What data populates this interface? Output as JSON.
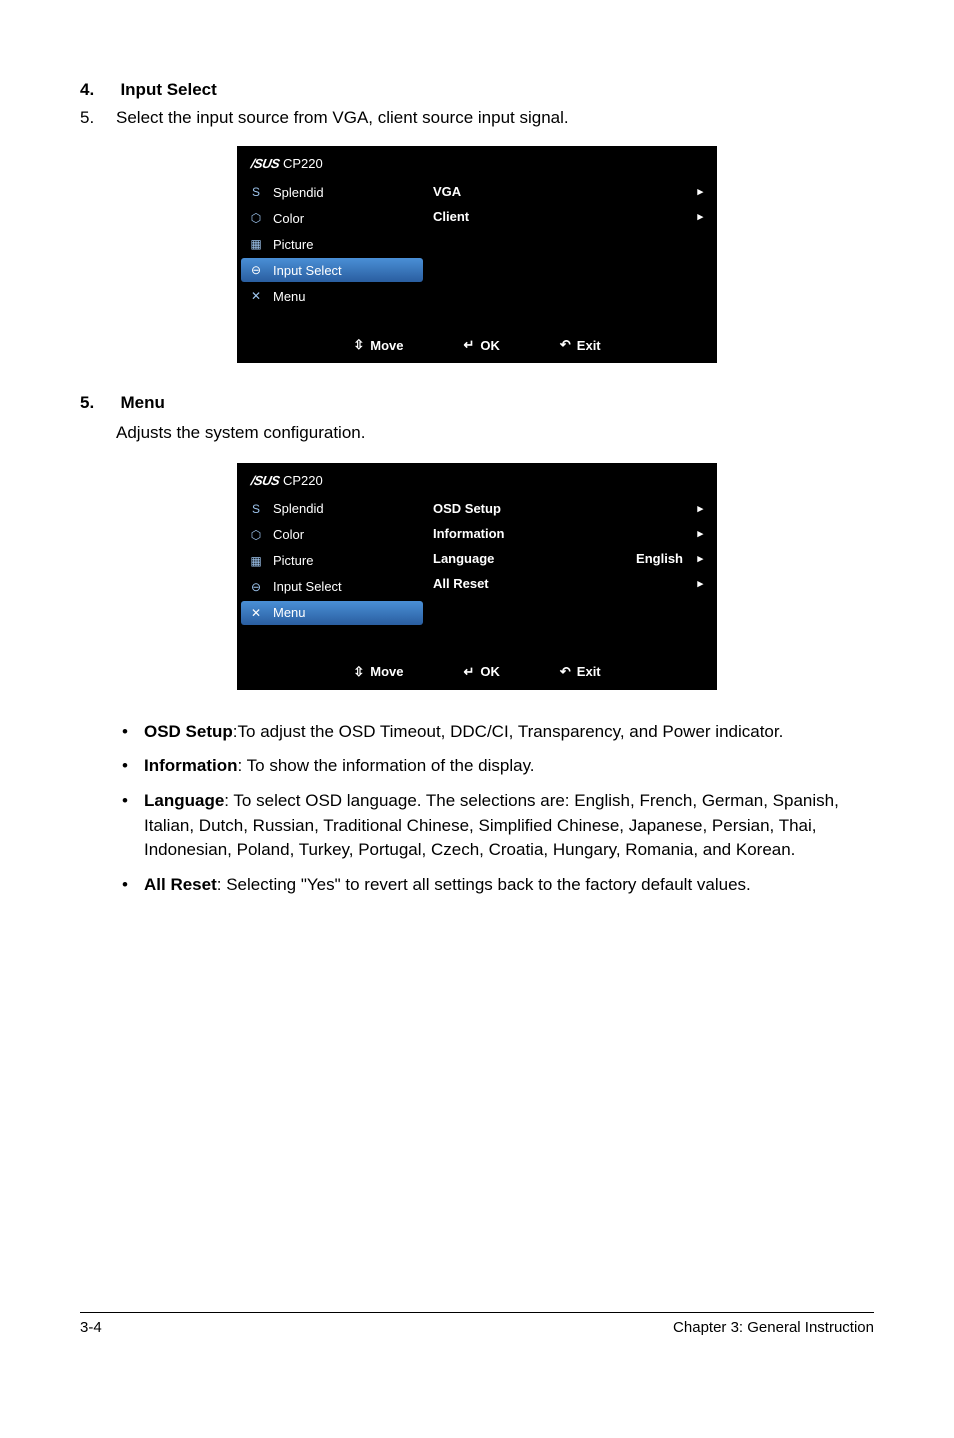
{
  "section4": {
    "num": "4.",
    "title": "Input Select",
    "step_num": "5.",
    "step_text": "Select the input source from VGA, client source input signal."
  },
  "osd1": {
    "brand": "/SUS",
    "model": "CP220",
    "menu": [
      "Splendid",
      "Color",
      "Picture",
      "Input Select",
      "Menu"
    ],
    "selected_idx": 3,
    "rows": [
      {
        "label": "VGA",
        "value": "",
        "arrow": "▸"
      },
      {
        "label": "Client",
        "value": "",
        "arrow": "▸"
      }
    ],
    "footer": {
      "move": "Move",
      "ok": "OK",
      "exit": "Exit"
    }
  },
  "section5": {
    "num": "5.",
    "title": "Menu",
    "intro": "Adjusts the system configuration."
  },
  "osd2": {
    "brand": "/SUS",
    "model": "CP220",
    "menu": [
      "Splendid",
      "Color",
      "Picture",
      "Input Select",
      "Menu"
    ],
    "selected_idx": 4,
    "rows": [
      {
        "label": "OSD Setup",
        "value": "",
        "arrow": "▸"
      },
      {
        "label": "Information",
        "value": "",
        "arrow": "▸"
      },
      {
        "label": "Language",
        "value": "English",
        "arrow": "▸"
      },
      {
        "label": "All Reset",
        "value": "",
        "arrow": "▸"
      }
    ],
    "footer": {
      "move": "Move",
      "ok": "OK",
      "exit": "Exit"
    }
  },
  "bullets": {
    "osd_setup_label": "OSD Setup",
    "osd_setup_text": ":To adjust the OSD Timeout, DDC/CI, Transparency, and Power indicator.",
    "info_label": "Information",
    "info_text": ": To show the information of the display.",
    "lang_label": "Language",
    "lang_text": ": To select OSD language. The selections are: English, French, German, Spanish, Italian, Dutch, Russian, Traditional Chinese, Simplified Chinese, Japanese, Persian, Thai, Indonesian, Poland, Turkey, Portugal, Czech, Croatia, Hungary, Romania, and Korean.",
    "reset_label": "All Reset",
    "reset_text": ": Selecting \"Yes\" to revert all settings back to the factory default values."
  },
  "footer": {
    "page": "3-4",
    "chapter": "Chapter 3: General Instruction"
  },
  "icons": {
    "splendid": "S",
    "color": "⬡",
    "picture": "▦",
    "input": "⊖",
    "menu": "✕",
    "move": "⇳",
    "ok_box": "↵",
    "exit": "↶"
  }
}
